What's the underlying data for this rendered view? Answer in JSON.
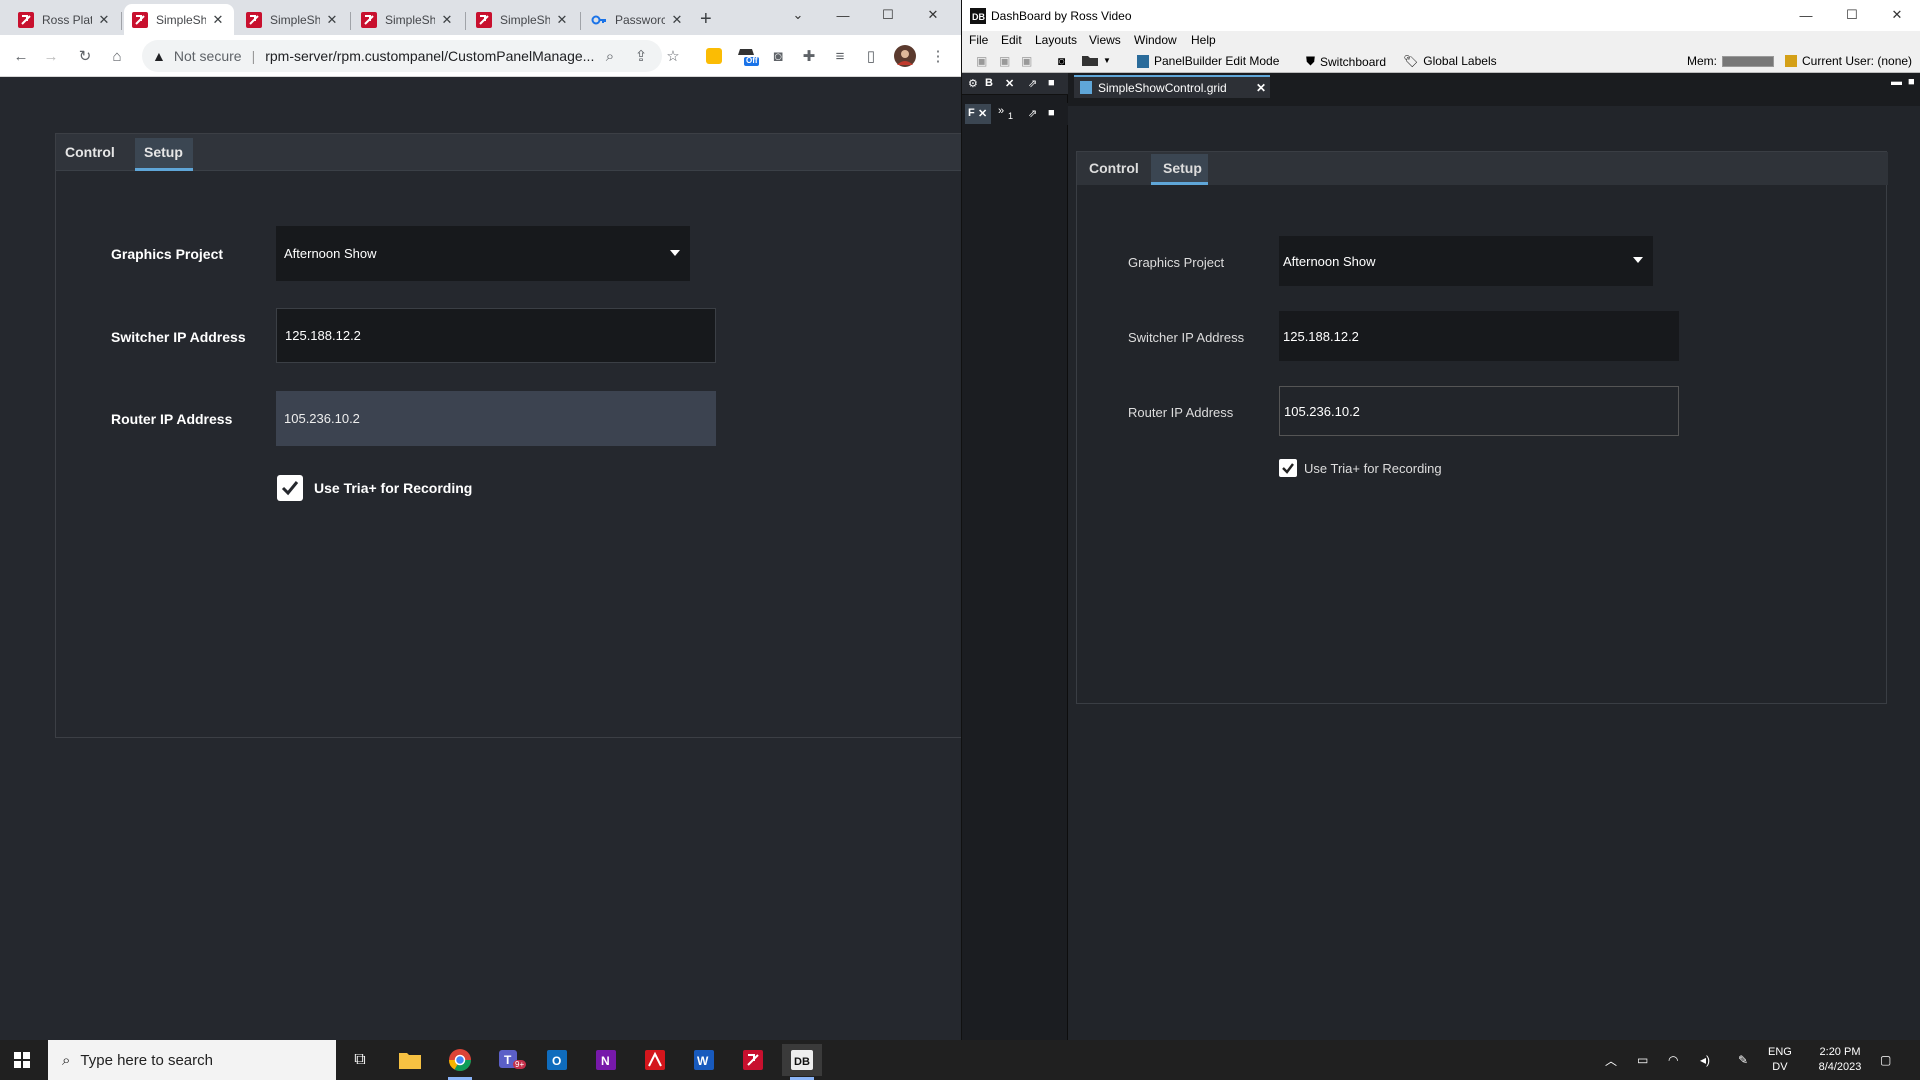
{
  "chrome": {
    "tabs": [
      {
        "label": "Ross Platf",
        "favicon": "ross-favicon"
      },
      {
        "label": "SimpleSh",
        "favicon": "ross-favicon"
      },
      {
        "label": "SimpleSh",
        "favicon": "ross-favicon"
      },
      {
        "label": "SimpleSh",
        "favicon": "ross-favicon"
      },
      {
        "label": "SimpleSh",
        "favicon": "ross-favicon"
      },
      {
        "label": "Passworc",
        "favicon": "key-favicon"
      }
    ],
    "active_tab_index": 1,
    "security_label": "Not secure",
    "url": "rpm-server/rpm.custompanel/CustomPanelManage...",
    "extension_badge": "Off"
  },
  "panel": {
    "tabs": [
      "Control",
      "Setup"
    ],
    "active_tab": "Setup",
    "graphics_project_label": "Graphics Project",
    "graphics_project_value": "Afternoon Show",
    "switcher_ip_label": "Switcher IP Address",
    "switcher_ip_value": "125.188.12.2",
    "router_ip_label": "Router IP Address",
    "router_ip_value": "105.236.10.2",
    "use_tria_label": "Use Tria+ for Recording",
    "use_tria_checked": true
  },
  "dashboard": {
    "window_title": "DashBoard by Ross Video",
    "menu": [
      "File",
      "Edit",
      "Layouts",
      "Views",
      "Window",
      "Help"
    ],
    "toolbar": {
      "panelbuilder_label": "PanelBuilder Edit Mode",
      "switchboard_label": "Switchboard",
      "global_labels_label": "Global Labels",
      "mem_label": "Mem:",
      "current_user_label": "Current User: (none)"
    },
    "left_panel": {
      "top_label": "B",
      "second_label": "F",
      "sub_label": "1"
    },
    "file_tab": "SimpleShowControl.grid"
  },
  "taskbar": {
    "search_placeholder": "Type here to search",
    "teams_badge": "9+",
    "lang_top": "ENG",
    "lang_bottom": "DV",
    "time": "2:20 PM",
    "date": "8/4/2023"
  },
  "colors": {
    "accent": "#5fa6d8",
    "panel_bg": "#25282e",
    "field_bg": "#17191c"
  }
}
